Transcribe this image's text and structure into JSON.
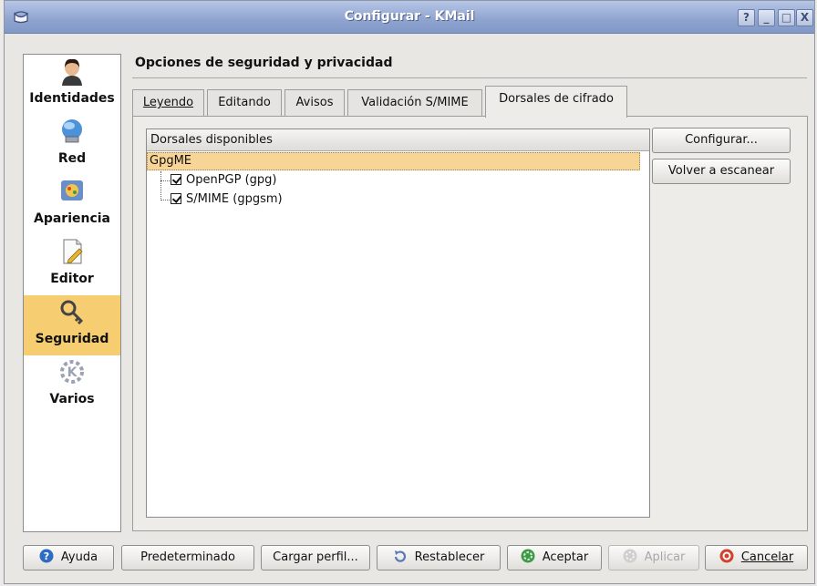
{
  "window": {
    "title": "Configurar - KMail",
    "controls": [
      "?",
      "_",
      "□",
      "X"
    ]
  },
  "sidebar": {
    "items": [
      {
        "label": "Identidades",
        "icon": "person-icon"
      },
      {
        "label": "Red",
        "icon": "globe-network-icon"
      },
      {
        "label": "Apariencia",
        "icon": "palette-icon"
      },
      {
        "label": "Editor",
        "icon": "document-pen-icon"
      },
      {
        "label": "Seguridad",
        "icon": "key-lock-icon",
        "selected": true
      },
      {
        "label": "Varios",
        "icon": "kde-gear-icon"
      }
    ]
  },
  "page": {
    "title": "Opciones de seguridad y privacidad"
  },
  "tabs": [
    {
      "label": "Leyendo"
    },
    {
      "label": "Editando"
    },
    {
      "label": "Avisos"
    },
    {
      "label": "Validación S/MIME"
    },
    {
      "label": "Dorsales de cifrado",
      "active": true
    }
  ],
  "backends": {
    "header": "Dorsales disponibles",
    "group": "GpgME",
    "items": [
      {
        "label": "OpenPGP (gpg)",
        "checked": true
      },
      {
        "label": "S/MIME (gpgsm)",
        "checked": true
      }
    ]
  },
  "side_buttons": {
    "configure": "Configurar...",
    "rescan": "Volver a escanear"
  },
  "footer_buttons": {
    "help": "Ayuda",
    "defaults": "Predeterminado",
    "load_profile": "Cargar perfil...",
    "reset": "Restablecer",
    "ok": "Aceptar",
    "apply": "Aplicar",
    "cancel": "Cancelar"
  },
  "colors": {
    "titlebar": "#8ea3cf",
    "selection": "#f7cd72",
    "group_highlight": "#f7d596"
  }
}
